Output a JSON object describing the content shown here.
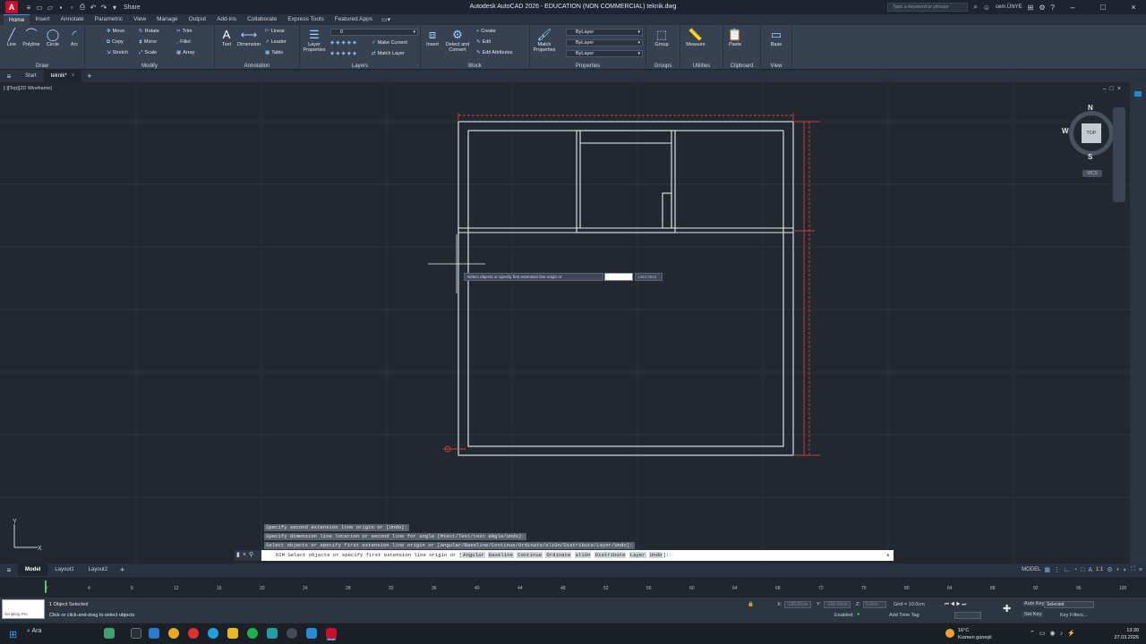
{
  "titlebar": {
    "title": "Autodesk AutoCAD 2026 - EDUCATION (NON COMMERCIAL)   teknik.dwg",
    "share": "Share",
    "search_placeholder": "Type a keyword or phrase",
    "user": "cem.ÜNYE"
  },
  "ribbon_tabs": [
    "Home",
    "Insert",
    "Annotate",
    "Parametric",
    "View",
    "Manage",
    "Output",
    "Add-ins",
    "Collaborate",
    "Express Tools",
    "Featured Apps"
  ],
  "ribbon": {
    "draw": {
      "label": "Draw",
      "line": "Line",
      "polyline": "Polyline",
      "circle": "Circle",
      "arc": "Arc"
    },
    "modify": {
      "label": "Modify",
      "move": "Move",
      "rotate": "Rotate",
      "trim": "Trim",
      "copy": "Copy",
      "mirror": "Mirror",
      "fillet": "Fillet",
      "stretch": "Stretch",
      "scale": "Scale",
      "array": "Array"
    },
    "annotation": {
      "label": "Annotation",
      "text": "Text",
      "dimension": "Dimension",
      "linear": "Linear",
      "leader": "Leader",
      "table": "Table"
    },
    "layers": {
      "label": "Layers",
      "layer_properties": "Layer Properties",
      "layer_value": "0",
      "make_current": "Make Current",
      "match_layer": "Match Layer"
    },
    "block": {
      "label": "Block",
      "insert": "Insert",
      "detect": "Detect and Convert",
      "create": "Create",
      "edit": "Edit",
      "edit_attributes": "Edit Attributes"
    },
    "properties": {
      "label": "Properties",
      "match": "Match Properties",
      "color": "ByLayer",
      "linetype": "ByLayer",
      "lineweight": "ByLayer"
    },
    "groups": {
      "label": "Groups",
      "group": "Group"
    },
    "utilities": {
      "label": "Utilities",
      "measure": "Measure"
    },
    "clipboard": {
      "label": "Clipboard",
      "paste": "Paste"
    },
    "view": {
      "label": "View",
      "base": "Base"
    }
  },
  "doc_tabs": {
    "start": "Start",
    "file": "teknik*"
  },
  "viewport": {
    "label": "[-][Top][2D Wireframe]",
    "viewcube": {
      "top": "TOP",
      "n": "N",
      "s": "S",
      "e": "E",
      "w": "W",
      "wcs": "WCS"
    },
    "tooltip": "Select objects or specify first extension line origin or",
    "tooltip_value": "1464.9042"
  },
  "command": {
    "history": [
      "Specify second extension line origin or [Undo]:",
      "Specify dimension line location or second line for angle [Mtext/Text/text aNgle/Undo]:",
      "Select objects or specify first extension line origin or [Angular/Baseline/Continue/Ordinate/aliGn/Distribute/Layer/Undo]:"
    ],
    "prompt_prefix": "DIM Select objects or specify first extension line origin or [",
    "options": [
      "Angular",
      "Baseline",
      "Continue",
      "Ordinate",
      "aliGn",
      "Distribute",
      "Layer",
      "Undo"
    ],
    "prompt_suffix": "]:"
  },
  "layout_tabs": [
    "Model",
    "Layout1",
    "Layout2"
  ],
  "status": {
    "model": "MODEL",
    "scale": "1:1"
  },
  "timeline_ticks": [
    "0",
    "2",
    "4",
    "6",
    "8",
    "10",
    "12",
    "14",
    "16",
    "18",
    "20",
    "22",
    "24",
    "26",
    "28",
    "30",
    "32",
    "34",
    "36",
    "38",
    "40",
    "42",
    "44",
    "46",
    "48",
    "50",
    "52",
    "54",
    "56",
    "58",
    "60",
    "62",
    "64",
    "66",
    "68",
    "70",
    "72",
    "74",
    "76",
    "78",
    "80",
    "82",
    "84",
    "86",
    "88",
    "90",
    "92",
    "94",
    "96",
    "98",
    "100"
  ],
  "anim_bar": {
    "selected": "1 Object Selected",
    "hint": "Click or click-and-drag to select objects",
    "scripting": "Scripting Pro",
    "x_label": "X:",
    "x_value": "-155.60cm",
    "y_label": "Y:",
    "y_value": "-156.60cm",
    "z_label": "Z:",
    "z_value": "0.0cm",
    "grid": "Grid = 10.0cm",
    "enabled": "Enabled:",
    "add_time_tag": "Add Time Tag",
    "auto_key": "Auto Key",
    "set_key": "Set Key",
    "selected_combo": "Selected",
    "key_filters": "Key Filters..."
  },
  "taskbar": {
    "search": "Ara",
    "weather_temp": "16°C",
    "weather_desc": "Kısmen güneşli",
    "time": "13:30",
    "date": "27.03.2026"
  }
}
